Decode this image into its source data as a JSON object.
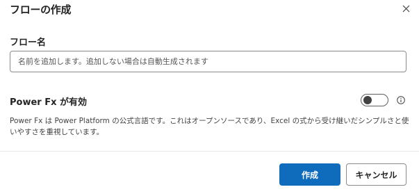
{
  "dialog": {
    "title": "フローの作成",
    "close_icon": "close-icon"
  },
  "flow_name": {
    "label": "フロー名",
    "value": "",
    "placeholder": "名前を追加します。追加しない場合は自動生成されます"
  },
  "power_fx": {
    "label": "Power Fx が有効",
    "toggle_on": false,
    "info_icon": "info-icon",
    "description": "Power Fx は Power Platform の公式言語です。これはオープンソースであり、Excel の式から受け継いだシンプルさと使いやすさを重視しています。"
  },
  "footer": {
    "create_label": "作成",
    "cancel_label": "キャンセル"
  },
  "colors": {
    "primary": "#0f6cbd",
    "text": "#242424",
    "border": "#8a8a8a"
  }
}
